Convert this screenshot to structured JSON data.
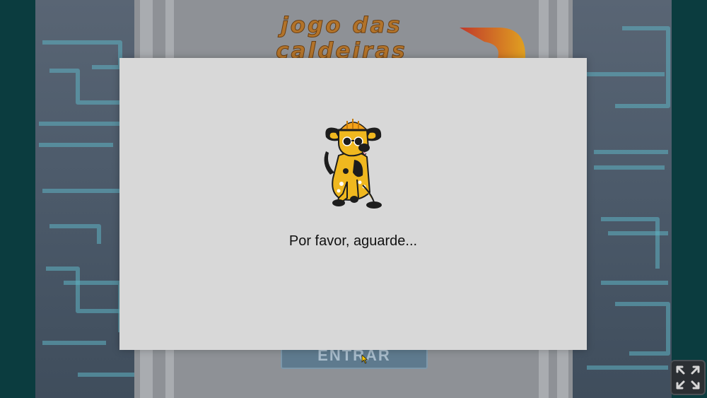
{
  "game": {
    "title": "jogo das caldeiras",
    "enter_label": "ENTRAR",
    "fullscreen_icon": "expand-icon"
  },
  "modal": {
    "loading_text": "Por favor, aguarde...",
    "mascot_icon": "dog-with-hard-hat"
  },
  "colors": {
    "background": "#596574",
    "circuit_lines": "#5fb3c2",
    "side_bars": "#0b3c3f",
    "title": "#b2732a",
    "modal": "#d8d8d8"
  }
}
